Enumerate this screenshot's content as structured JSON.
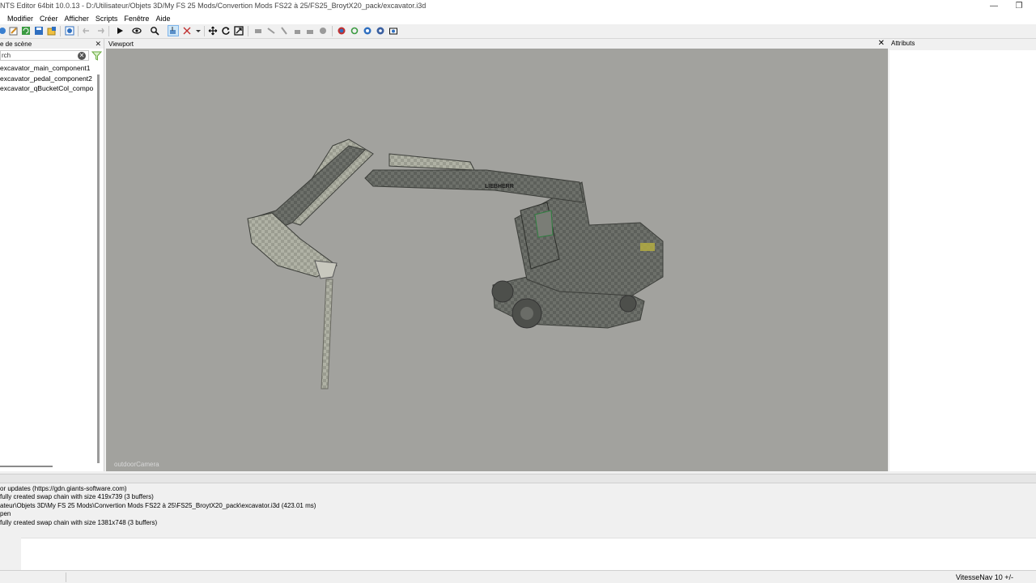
{
  "window": {
    "title": "NTS Editor 64bit 10.0.13 - D:/Utilisateur/Objets 3D/My FS 25 Mods/Convertion Mods FS22 à 25/FS25_BroytX20_pack/excavator.i3d",
    "minimize": "—",
    "restore": "❐"
  },
  "menu": [
    "Modifier",
    "Créer",
    "Afficher",
    "Scripts",
    "Fenêtre",
    "Aide"
  ],
  "scene_panel": {
    "title": "e de scène",
    "close": "✕",
    "search_value": "rch",
    "clear": "✕",
    "items": [
      "excavator_main_component1",
      "excavator_pedal_component2",
      "excavator_qBucketCol_compo"
    ]
  },
  "viewport": {
    "title": "Viewport",
    "close": "✕",
    "camera": "outdoorCamera",
    "model_brand": "LIEBHERR"
  },
  "attributes": {
    "title": "Attributs"
  },
  "log": [
    "or updates (https://gdn.giants-software.com)",
    "fully created swap chain with size 419x739 (3 buffers)",
    "ateur\\Objets 3D\\My FS 25 Mods\\Convertion Mods FS22 à 25\\FS25_BroytX20_pack\\excavator.i3d (423.01 ms)",
    "pen",
    "fully created swap chain with size 1381x748 (3 buffers)"
  ],
  "status": {
    "speed": "VitesseNav 10 +/-"
  },
  "colors": {
    "viewport_bg": "#a2a29e",
    "accent": "#2f7fd0",
    "model": "#5a5c58"
  }
}
